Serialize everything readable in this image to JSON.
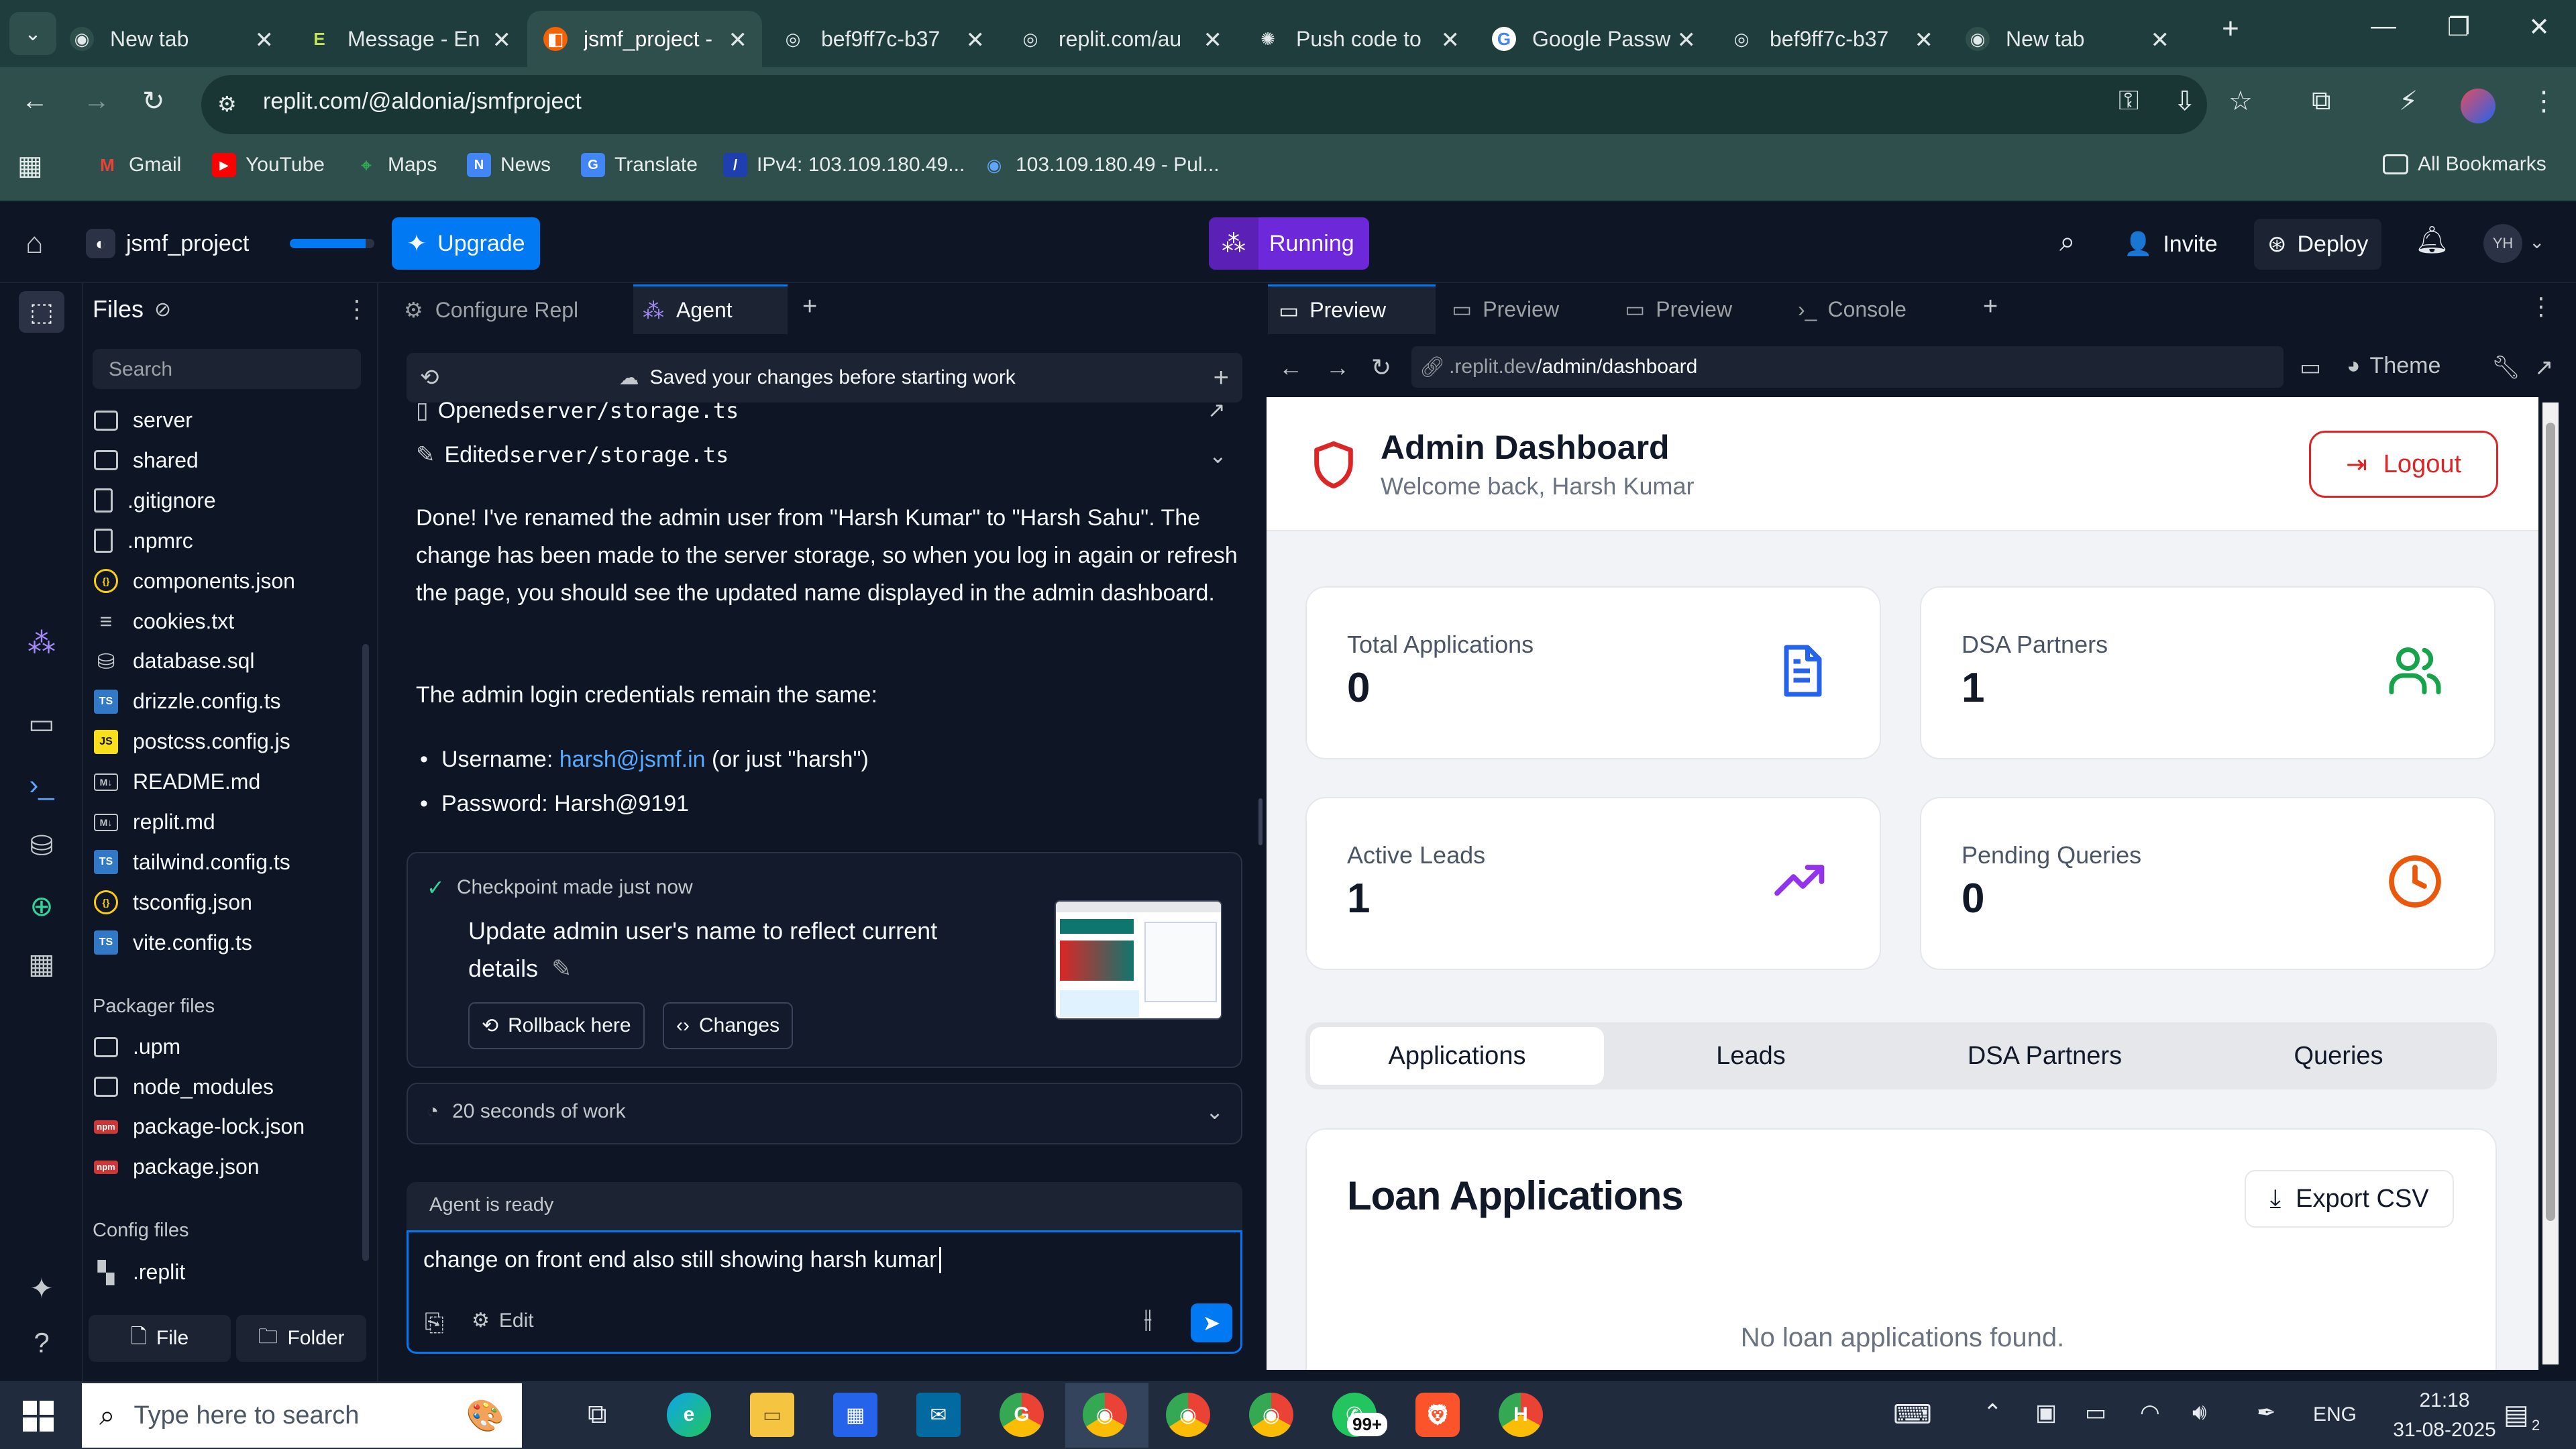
{
  "browser": {
    "tabs": [
      {
        "title": "New tab",
        "icon": "chrome-icon"
      },
      {
        "title": "Message - En",
        "icon": "e-icon"
      },
      {
        "title": "jsmf_project -",
        "icon": "replit-icon",
        "active": true
      },
      {
        "title": "bef9ff7c-b37",
        "icon": "globe-icon"
      },
      {
        "title": "replit.com/au",
        "icon": "globe-icon"
      },
      {
        "title": "Push code to",
        "icon": "openai-icon"
      },
      {
        "title": "Google Passw",
        "icon": "google-icon"
      },
      {
        "title": "bef9ff7c-b37",
        "icon": "globe-icon"
      },
      {
        "title": "New tab",
        "icon": "chrome-icon"
      }
    ],
    "url": "replit.com/@aldonia/jsmfproject",
    "bookmarks": [
      {
        "label": "Gmail"
      },
      {
        "label": "YouTube"
      },
      {
        "label": "Maps"
      },
      {
        "label": "News"
      },
      {
        "label": "Translate"
      },
      {
        "label": "IPv4: 103.109.180.49..."
      },
      {
        "label": "103.109.180.49 - Pul..."
      }
    ],
    "all_bookmarks": "All Bookmarks"
  },
  "replit": {
    "project_name": "jsmf_project",
    "upgrade_label": "Upgrade",
    "running_label": "Running",
    "invite_label": "Invite",
    "deploy_label": "Deploy",
    "avatar_initials": "YH"
  },
  "files": {
    "title": "Files",
    "search_placeholder": "Search",
    "items": [
      {
        "name": "server",
        "kind": "folder"
      },
      {
        "name": "shared",
        "kind": "folder"
      },
      {
        "name": ".gitignore",
        "kind": "file"
      },
      {
        "name": ".npmrc",
        "kind": "file"
      },
      {
        "name": "components.json",
        "kind": "json"
      },
      {
        "name": "cookies.txt",
        "kind": "text"
      },
      {
        "name": "database.sql",
        "kind": "db"
      },
      {
        "name": "drizzle.config.ts",
        "kind": "ts"
      },
      {
        "name": "postcss.config.js",
        "kind": "js"
      },
      {
        "name": "README.md",
        "kind": "md"
      },
      {
        "name": "replit.md",
        "kind": "md"
      },
      {
        "name": "tailwind.config.ts",
        "kind": "ts"
      },
      {
        "name": "tsconfig.json",
        "kind": "json"
      },
      {
        "name": "vite.config.ts",
        "kind": "ts"
      }
    ],
    "packager_title": "Packager files",
    "packager_items": [
      {
        "name": ".upm",
        "kind": "folder"
      },
      {
        "name": "node_modules",
        "kind": "folder"
      },
      {
        "name": "package-lock.json",
        "kind": "npm"
      },
      {
        "name": "package.json",
        "kind": "npm"
      }
    ],
    "config_title": "Config files",
    "config_items": [
      {
        "name": ".replit",
        "kind": "replit"
      }
    ],
    "file_button": "File",
    "folder_button": "Folder"
  },
  "agent_tabs": {
    "configure": "Configure Repl",
    "agent": "Agent"
  },
  "agent": {
    "saved_banner": "Saved your changes before starting work",
    "opened_prefix": "Opened ",
    "opened_file": "server/storage.ts",
    "edited_prefix": "Edited ",
    "edited_file": "server/storage.ts",
    "message_p1": "Done! I've renamed the admin user from \"Harsh Kumar\" to \"Harsh Sahu\". The change has been made to the server storage, so when you log in again or refresh the page, you should see the updated name displayed in the admin dashboard.",
    "message_p2": "The admin login credentials remain the same:",
    "username_label": "Username: ",
    "username_link": "harsh@jsmf.in",
    "username_suffix": " (or just \"harsh\")",
    "password_line": "Password: Harsh@9191",
    "checkpoint_label": "Checkpoint made just now",
    "checkpoint_title": "Update admin user's name to reflect current details",
    "rollback_label": "Rollback here",
    "changes_label": "Changes",
    "work_time": "20 seconds of work",
    "status": "Agent is ready",
    "input_value": "change on front end also still showing harsh kumar",
    "edit_label": "Edit"
  },
  "preview_tabs": [
    {
      "label": "Preview",
      "active": true
    },
    {
      "label": "Preview"
    },
    {
      "label": "Preview"
    },
    {
      "label": "Console"
    }
  ],
  "preview_bar": {
    "url_prefix": ".replit.dev",
    "url_path": "/admin/dashboard",
    "theme_label": "Theme"
  },
  "dashboard": {
    "title": "Admin Dashboard",
    "subtitle": "Welcome back, Harsh Kumar",
    "logout_label": "Logout",
    "stats": [
      {
        "label": "Total Applications",
        "value": "0",
        "icon": "document-icon",
        "color": "#2563eb"
      },
      {
        "label": "DSA Partners",
        "value": "1",
        "icon": "users-icon",
        "color": "#16a34a"
      },
      {
        "label": "Active Leads",
        "value": "1",
        "icon": "trending-up-icon",
        "color": "#9333ea"
      },
      {
        "label": "Pending Queries",
        "value": "0",
        "icon": "clock-icon",
        "color": "#ea580c"
      }
    ],
    "tabs": [
      "Applications",
      "Leads",
      "DSA Partners",
      "Queries"
    ],
    "section_title": "Loan Applications",
    "export_label": "Export CSV",
    "empty_text": "No loan applications found."
  },
  "taskbar": {
    "search_placeholder": "Type here to search",
    "badge": "99+",
    "language": "ENG",
    "time": "21:18",
    "date": "31-08-2025",
    "notification_count": "2"
  }
}
